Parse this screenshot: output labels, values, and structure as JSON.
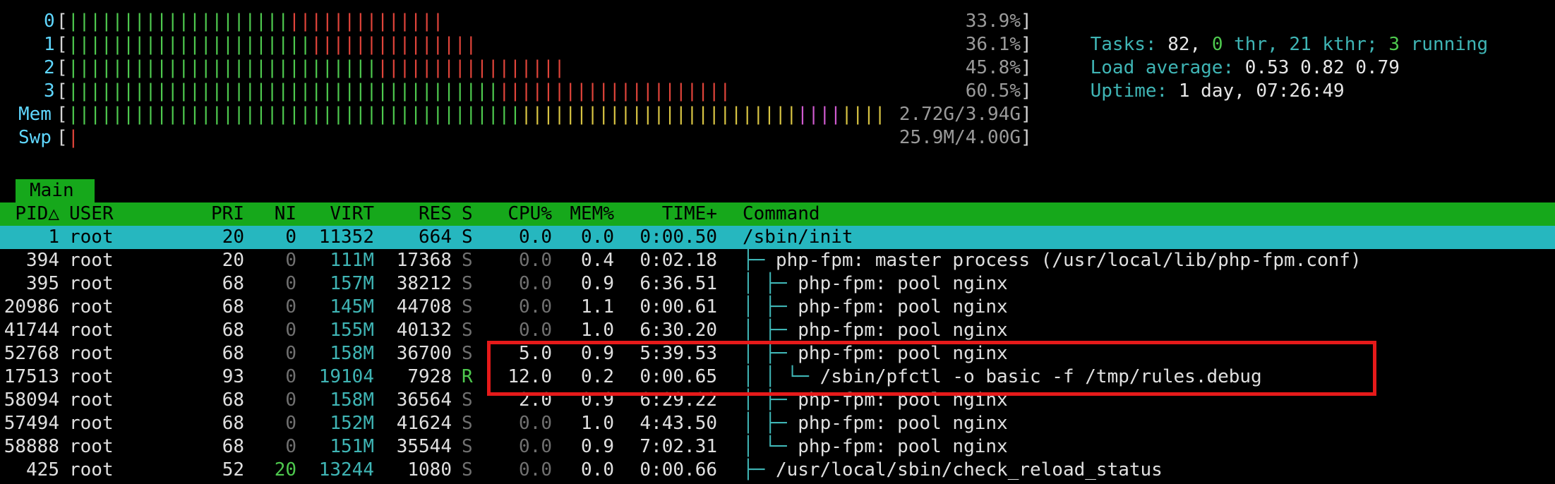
{
  "meters": {
    "cpus": [
      {
        "label": "0",
        "percent": "33.9%",
        "green": 20,
        "red": 14
      },
      {
        "label": "1",
        "percent": "36.1%",
        "green": 22,
        "red": 15
      },
      {
        "label": "2",
        "percent": "45.8%",
        "green": 28,
        "red": 17
      },
      {
        "label": "3",
        "percent": "60.5%",
        "green": 39,
        "red": 21
      }
    ],
    "mem": {
      "label": "Mem",
      "value": "2.72G/3.94G"
    },
    "swp": {
      "label": "Swp",
      "value": "25.9M/4.00G"
    }
  },
  "info": {
    "tasks_label": "Tasks:",
    "tasks_count": "82,",
    "thr_count": "0",
    "thr_label": "thr,",
    "kthr_count": "21",
    "kthr_label": "kthr;",
    "running_count": "3",
    "running_label": "running",
    "load_label": "Load average:",
    "load_1": "0.53",
    "load_5": "0.82",
    "load_15": "0.79",
    "uptime_label": "Uptime:",
    "uptime_value": "1 day, 07:26:49"
  },
  "tab": {
    "main_label": "Main"
  },
  "columns": {
    "pid": "PID",
    "user": "USER",
    "pri": "PRI",
    "ni": "NI",
    "virt": "VIRT",
    "res": "RES",
    "s": "S",
    "cpu": "CPU%",
    "mem": "MEM%",
    "time": "TIME+",
    "command": "Command"
  },
  "processes": [
    {
      "pid": "1",
      "user": "root",
      "pri": "20",
      "ni": "0",
      "virt": "11352",
      "res": "664",
      "s": "S",
      "cpu": "0.0",
      "mem": "0.0",
      "time": "0:00.50",
      "tree": "",
      "cmd": "/sbin/init"
    },
    {
      "pid": "394",
      "user": "root",
      "pri": "20",
      "ni": "0",
      "virt": "111M",
      "res": "17368",
      "s": "S",
      "cpu": "0.0",
      "mem": "0.4",
      "time": "0:02.18",
      "tree": "├─",
      "cmd": "php-fpm: master process (/usr/local/lib/php-fpm.conf)"
    },
    {
      "pid": "395",
      "user": "root",
      "pri": "68",
      "ni": "0",
      "virt": "157M",
      "res": "38212",
      "s": "S",
      "cpu": "0.0",
      "mem": "0.9",
      "time": "6:36.51",
      "tree": "│ ├─",
      "cmd": "php-fpm: pool nginx"
    },
    {
      "pid": "20986",
      "user": "root",
      "pri": "68",
      "ni": "0",
      "virt": "145M",
      "res": "44708",
      "s": "S",
      "cpu": "0.0",
      "mem": "1.1",
      "time": "0:00.61",
      "tree": "│ ├─",
      "cmd": "php-fpm: pool nginx"
    },
    {
      "pid": "41744",
      "user": "root",
      "pri": "68",
      "ni": "0",
      "virt": "155M",
      "res": "40132",
      "s": "S",
      "cpu": "0.0",
      "mem": "1.0",
      "time": "6:30.20",
      "tree": "│ ├─",
      "cmd": "php-fpm: pool nginx"
    },
    {
      "pid": "52768",
      "user": "root",
      "pri": "68",
      "ni": "0",
      "virt": "158M",
      "res": "36700",
      "s": "S",
      "cpu": "5.0",
      "mem": "0.9",
      "time": "5:39.53",
      "tree": "│ ├─",
      "cmd": "php-fpm: pool nginx"
    },
    {
      "pid": "17513",
      "user": "root",
      "pri": "93",
      "ni": "0",
      "virt": "19104",
      "res": "7928",
      "s": "R",
      "cpu": "12.0",
      "mem": "0.2",
      "time": "0:00.65",
      "tree": "│ │ └─",
      "cmd": "/sbin/pfctl -o basic -f /tmp/rules.debug"
    },
    {
      "pid": "58094",
      "user": "root",
      "pri": "68",
      "ni": "0",
      "virt": "158M",
      "res": "36564",
      "s": "S",
      "cpu": "2.0",
      "mem": "0.9",
      "time": "6:29.22",
      "tree": "│ ├─",
      "cmd": "php-fpm: pool nginx"
    },
    {
      "pid": "57494",
      "user": "root",
      "pri": "68",
      "ni": "0",
      "virt": "152M",
      "res": "41624",
      "s": "S",
      "cpu": "0.0",
      "mem": "1.0",
      "time": "4:43.50",
      "tree": "│ ├─",
      "cmd": "php-fpm: pool nginx"
    },
    {
      "pid": "58888",
      "user": "root",
      "pri": "68",
      "ni": "0",
      "virt": "151M",
      "res": "35544",
      "s": "S",
      "cpu": "0.0",
      "mem": "0.9",
      "time": "7:02.31",
      "tree": "│ └─",
      "cmd": "php-fpm: pool nginx"
    },
    {
      "pid": "425",
      "user": "root",
      "pri": "52",
      "ni": "20",
      "virt": "13244",
      "res": "1080",
      "s": "S",
      "cpu": "0.0",
      "mem": "0.0",
      "time": "0:00.66",
      "tree": "├─",
      "cmd": "/usr/local/sbin/check_reload_status"
    }
  ],
  "colors": {
    "header_bg": "#16a81b",
    "selected_bg": "#26b7bf",
    "highlight_box": "#e61a1a"
  }
}
